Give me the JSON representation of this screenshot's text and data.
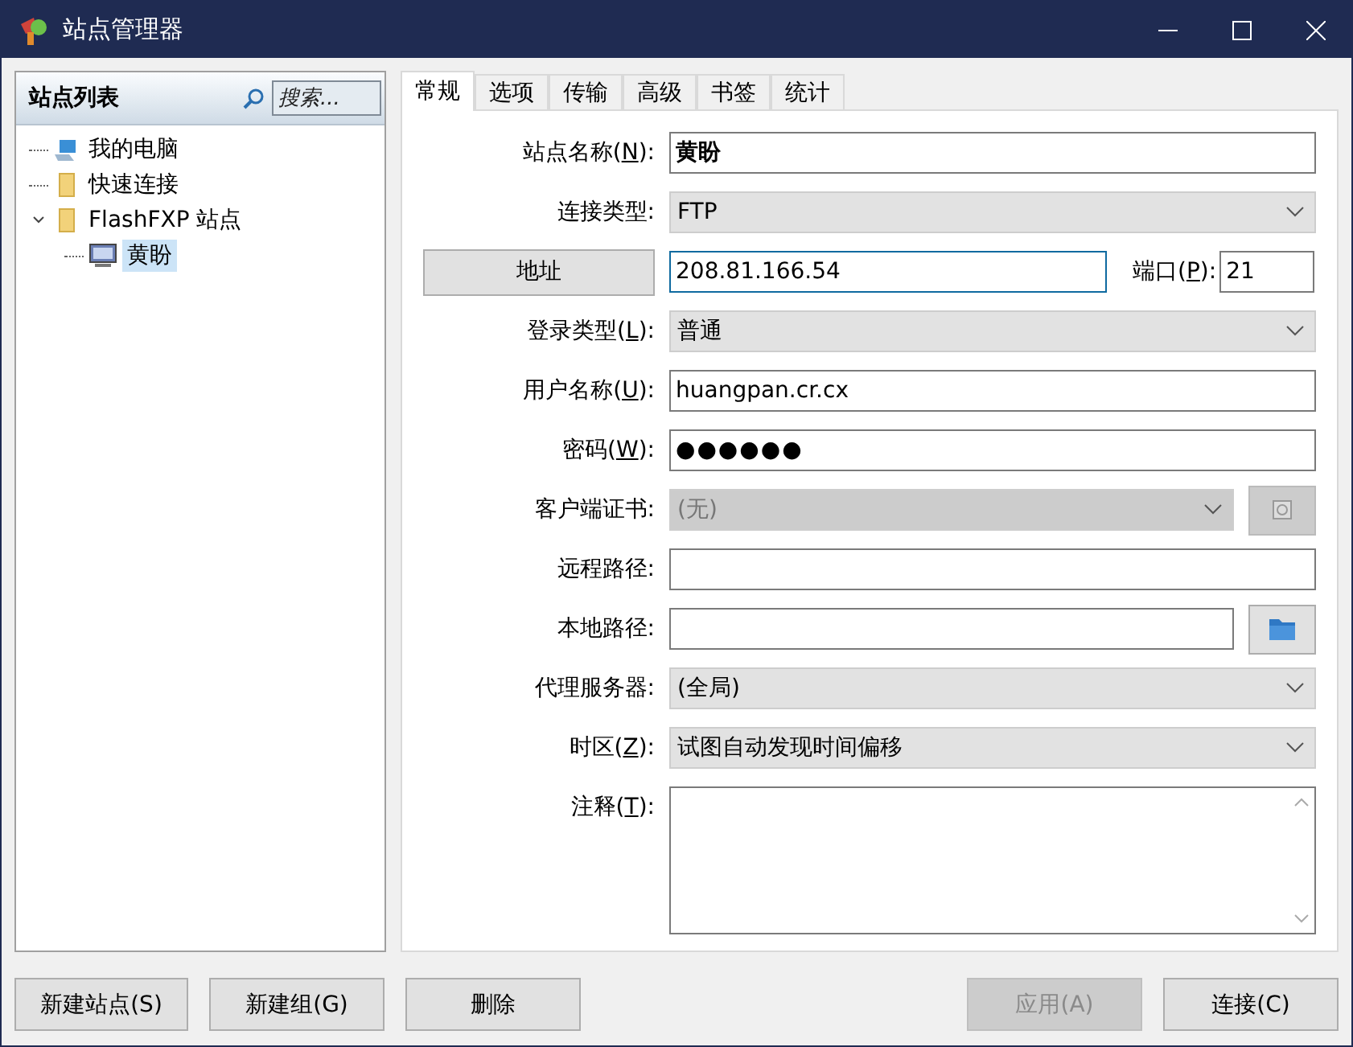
{
  "window": {
    "title": "站点管理器"
  },
  "sidebar": {
    "title": "站点列表",
    "search_placeholder": "搜索...",
    "tree": [
      {
        "label": "我的电脑",
        "kind": "computer",
        "selected": false
      },
      {
        "label": "快速连接",
        "kind": "folder",
        "selected": false
      },
      {
        "label": "FlashFXP 站点",
        "kind": "folder",
        "expanded": true,
        "selected": false,
        "children": [
          {
            "label": "黄盼",
            "kind": "monitor",
            "selected": true
          }
        ]
      }
    ]
  },
  "tabs": [
    {
      "label": "常规",
      "selected": true
    },
    {
      "label": "选项",
      "selected": false
    },
    {
      "label": "传输",
      "selected": false
    },
    {
      "label": "高级",
      "selected": false
    },
    {
      "label": "书签",
      "selected": false
    },
    {
      "label": "统计",
      "selected": false
    }
  ],
  "fields": [
    {
      "kind": "text",
      "label_before": "站点名称(",
      "mnemonic": "N",
      "label_after": "):",
      "value": "黄盼",
      "bold": true
    },
    {
      "kind": "combo",
      "label_before": "连接类型:",
      "value": "FTP",
      "disabled": false
    },
    {
      "kind": "address",
      "button": "地址",
      "value": "208.81.166.54",
      "port_label_before": "端口(",
      "port_mnemonic": "P",
      "port_label_after": "):",
      "port": "21"
    },
    {
      "kind": "combo",
      "label_before": "登录类型(",
      "mnemonic": "L",
      "label_after": "):",
      "value": "普通",
      "disabled": false
    },
    {
      "kind": "text",
      "label_before": "用户名称(",
      "mnemonic": "U",
      "label_after": "):",
      "value": "huangpan.cr.cx"
    },
    {
      "kind": "password",
      "label_before": "密码(",
      "mnemonic": "W",
      "label_after": "):",
      "value": "●●●●●●"
    },
    {
      "kind": "combo-button",
      "label_before": "客户端证书:",
      "value": "(无)",
      "disabled": true
    },
    {
      "kind": "text",
      "label_before": "远程路径:"
    },
    {
      "kind": "folder",
      "label_before": "本地路径:"
    },
    {
      "kind": "combo",
      "label_before": "代理服务器:",
      "value": "(全局)",
      "disabled": false
    },
    {
      "kind": "combo",
      "label_before": "时区(",
      "mnemonic": "Z",
      "label_after": "):",
      "value": "试图自动发现时间偏移",
      "disabled": false
    },
    {
      "kind": "textarea",
      "label_before": "注释(",
      "mnemonic": "T",
      "label_after": "):"
    }
  ],
  "buttons_left": [
    {
      "label": "新建站点(S)",
      "disabled": false
    },
    {
      "label": "新建组(G)",
      "disabled": false
    },
    {
      "label": "删除",
      "disabled": false
    }
  ],
  "buttons_right": [
    {
      "label": "应用(A)",
      "disabled": true
    },
    {
      "label": "连接(C)",
      "disabled": false
    }
  ]
}
